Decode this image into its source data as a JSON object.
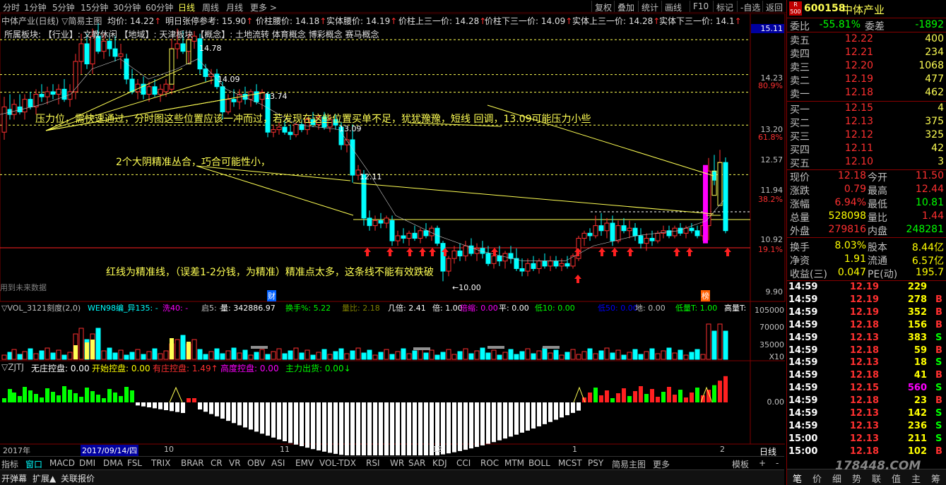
{
  "top_tabs": [
    "分时",
    "1分钟",
    "5分钟",
    "15分钟",
    "30分钟",
    "60分钟",
    "日线",
    "周线",
    "月线",
    "更多 >"
  ],
  "active_tab": "日线",
  "right_tools": [
    "复权",
    "叠加",
    "统计",
    "画线",
    "F10",
    "标记",
    "-自选",
    "返回"
  ],
  "header": {
    "title": "中体产业(日线) ▽简易主图",
    "items": [
      {
        "label": "均价: 14.22",
        "color": "#ffffff"
      },
      {
        "label": "明日张停参考: 15.90",
        "color": "#ffffff"
      },
      {
        "label": "价柱腰价: 14.18",
        "color": "#ffffff"
      },
      {
        "label": "实体腰价: 14.19",
        "color": "#ffffff"
      },
      {
        "label": "价柱上三一价: 14.28",
        "color": "#ffffff"
      },
      {
        "label": "价柱下三一价: 14.09",
        "color": "#ffffff"
      },
      {
        "label": "实体上三一价: 14.28",
        "color": "#ffffff"
      },
      {
        "label": "实体下三一价: 14.1",
        "color": "#ffffff"
      }
    ]
  },
  "info_line": "所属板块:    【行业】: 文教休闲     【地域】: 天津板块     【概念】: 土地流转 体育概念 博彩概念 赛马概念",
  "price_levels": [
    {
      "label": "14.78"
    },
    {
      "label": "14.09"
    },
    {
      "label": "13.74"
    },
    {
      "label": "13.09"
    },
    {
      "label": "12.11"
    },
    {
      "label": "←10.00"
    }
  ],
  "annotations": [
    {
      "text": "压力位，需快速通过，分时图这些位置应该一冲而过，若发现在这些位置买单不足，犹犹豫豫，短线  回调，13.09可能压力小些"
    },
    {
      "text": "2个大阴精准丛合，巧合可能性小，"
    },
    {
      "text": "红线为精准线，（误差1-2分钱，为精准）精准点太多，这条线不能有效跌破"
    },
    {
      "text": "用到未来数据"
    }
  ],
  "markers": [
    "财",
    "榜"
  ],
  "price_axis": [
    {
      "label": "15.11",
      "highlight": true
    },
    {
      "label": "14.23"
    },
    {
      "label": "80.9%",
      "pct": true
    },
    {
      "label": "13.20"
    },
    {
      "label": "61.8%",
      "pct": true
    },
    {
      "label": "12.57"
    },
    {
      "label": "11.94"
    },
    {
      "label": "38.2%",
      "pct": true
    },
    {
      "label": "10.92"
    },
    {
      "label": "19.1%",
      "pct": true
    },
    {
      "label": "9.90"
    }
  ],
  "vol_header": {
    "items": [
      {
        "label": "▽VOL_3121刻度(2,0)",
        "color": "#c0c0c0"
      },
      {
        "label": "WEN98编_异135: -",
        "color": "#00ffff"
      },
      {
        "label": "洗40: -",
        "color": "#ff00ff"
      },
      {
        "label": "启5: -",
        "color": "#c0c0c0"
      },
      {
        "label": "量: 342886.97",
        "color": "#ffffff"
      },
      {
        "label": "换手%: 5.22",
        "color": "#00ff00"
      },
      {
        "label": "量比: 2.18",
        "color": "#808000"
      },
      {
        "label": "几倍: 2.41",
        "color": "#ffffff"
      },
      {
        "label": "倍: 1.00",
        "color": "#ffffff"
      },
      {
        "label": "倍缩: 0.00",
        "color": "#ff00ff"
      },
      {
        "label": "平: 0.00",
        "color": "#ffffff"
      },
      {
        "label": "低10: 0.00",
        "color": "#00ff00"
      },
      {
        "label": "低50: 0.00",
        "color": "#0000ff"
      },
      {
        "label": "地: 0.00",
        "color": "#c0c0c0"
      },
      {
        "label": "低量T: 1.00",
        "color": "#00ff00"
      },
      {
        "label": "高量T:",
        "color": "#ffffff"
      }
    ],
    "axis": [
      "105000",
      "70000",
      "35000",
      "X10"
    ]
  },
  "zj_header": {
    "items": [
      {
        "label": "▽ZJTJ",
        "color": "#c0c0c0"
      },
      {
        "label": "无庄控盘: 0.00",
        "color": "#ffffff"
      },
      {
        "label": "开始控盘: 0.00",
        "color": "#ffff00"
      },
      {
        "label": "有庄控盘: 1.49↑",
        "color": "#ff3030"
      },
      {
        "label": "高度控盘: 0.00",
        "color": "#ff00ff"
      },
      {
        "label": "主力出货: 0.00↓",
        "color": "#00ff00"
      }
    ],
    "axis": [
      "0.00"
    ]
  },
  "date_axis": [
    {
      "label": "2017年"
    },
    {
      "label": "2017/09/14/四",
      "highlight": true
    },
    {
      "label": "10"
    },
    {
      "label": "11"
    },
    {
      "label": "12"
    },
    {
      "label": "1"
    },
    {
      "label": "2"
    }
  ],
  "date_axis_right": "日线",
  "bottom_tabs": [
    "指标",
    "窗口",
    "MACD",
    "DMI",
    "DMA",
    "FSL",
    "TRIX",
    "BRAR",
    "CR",
    "VR",
    "OBV",
    "ASI",
    "EMV",
    "VOL-TDX",
    "RSI",
    "WR",
    "SAR",
    "KDJ",
    "CCI",
    "ROC",
    "MTM",
    "BOLL",
    "MCST",
    "PSY",
    "简易主图",
    "更多"
  ],
  "bottom_right": [
    "模板",
    "+",
    "-"
  ],
  "statusbar": [
    "开弹幕",
    "扩展▲",
    "关联报价"
  ],
  "quote": {
    "code": "600158",
    "name": "中体产业",
    "badge_top": "R",
    "badge_bottom": "500",
    "weibi_label": "委比",
    "weibi_value": "-55.81%",
    "weicha_label": "委差",
    "weicha_value": "-1892",
    "sells": [
      {
        "label": "卖五",
        "price": "12.22",
        "vol": "400"
      },
      {
        "label": "卖四",
        "price": "12.21",
        "vol": "234"
      },
      {
        "label": "卖三",
        "price": "12.20",
        "vol": "1068"
      },
      {
        "label": "卖二",
        "price": "12.19",
        "vol": "477"
      },
      {
        "label": "卖一",
        "price": "12.18",
        "vol": "462"
      }
    ],
    "buys": [
      {
        "label": "买一",
        "price": "12.15",
        "vol": "4"
      },
      {
        "label": "买二",
        "price": "12.13",
        "vol": "375"
      },
      {
        "label": "买三",
        "price": "12.12",
        "vol": "325"
      },
      {
        "label": "买四",
        "price": "12.11",
        "vol": "42"
      },
      {
        "label": "买五",
        "price": "12.10",
        "vol": "3"
      }
    ],
    "stats": [
      {
        "l1": "现价",
        "v1": "12.18",
        "c1": "#ff3030",
        "l2": "今开",
        "v2": "11.50",
        "c2": "#ff3030"
      },
      {
        "l1": "涨跌",
        "v1": "0.79",
        "c1": "#ff3030",
        "l2": "最高",
        "v2": "12.44",
        "c2": "#ff3030"
      },
      {
        "l1": "涨幅",
        "v1": "6.94%",
        "c1": "#ff3030",
        "l2": "最低",
        "v2": "10.81",
        "c2": "#00ff00"
      },
      {
        "l1": "总量",
        "v1": "528098",
        "c1": "#ffff00",
        "l2": "量比",
        "v2": "1.44",
        "c2": "#ff3030"
      },
      {
        "l1": "外盘",
        "v1": "279816",
        "c1": "#ff3030",
        "l2": "内盘",
        "v2": "248281",
        "c2": "#00ff00"
      },
      {
        "l1": "换手",
        "v1": "8.03%",
        "c1": "#ffff00",
        "l2": "股本",
        "v2": "8.44亿",
        "c2": "#ffff00"
      },
      {
        "l1": "净资",
        "v1": "1.91",
        "c1": "#ffff00",
        "l2": "流通",
        "v2": "6.57亿",
        "c2": "#ffff00"
      },
      {
        "l1": "收益(三)",
        "v1": "0.047",
        "c1": "#ffff00",
        "l2": "PE(动)",
        "v2": "195.7",
        "c2": "#ffff00"
      }
    ],
    "ticks": [
      {
        "time": "14:59",
        "price": "12.19",
        "vol": "229",
        "bs": "",
        "pc": "#ff3030",
        "vc": "#ffff00"
      },
      {
        "time": "14:59",
        "price": "12.19",
        "vol": "278",
        "bs": "B",
        "pc": "#ff3030",
        "vc": "#ffff00"
      },
      {
        "time": "14:59",
        "price": "12.19",
        "vol": "352",
        "bs": "B",
        "pc": "#ff3030",
        "vc": "#ffff00"
      },
      {
        "time": "14:59",
        "price": "12.18",
        "vol": "156",
        "bs": "B",
        "pc": "#ff3030",
        "vc": "#ffff00"
      },
      {
        "time": "14:59",
        "price": "12.13",
        "vol": "383",
        "bs": "S",
        "pc": "#ff3030",
        "vc": "#ffff00"
      },
      {
        "time": "14:59",
        "price": "12.18",
        "vol": "59",
        "bs": "B",
        "pc": "#ff3030",
        "vc": "#ffff00"
      },
      {
        "time": "14:59",
        "price": "12.13",
        "vol": "18",
        "bs": "S",
        "pc": "#ff3030",
        "vc": "#ffff00"
      },
      {
        "time": "14:59",
        "price": "12.18",
        "vol": "41",
        "bs": "B",
        "pc": "#ff3030",
        "vc": "#ffff00"
      },
      {
        "time": "14:59",
        "price": "12.15",
        "vol": "560",
        "bs": "S",
        "pc": "#ff3030",
        "vc": "#ff00ff"
      },
      {
        "time": "14:59",
        "price": "12.18",
        "vol": "23",
        "bs": "B",
        "pc": "#ff3030",
        "vc": "#ffff00"
      },
      {
        "time": "14:59",
        "price": "12.13",
        "vol": "142",
        "bs": "S",
        "pc": "#ff3030",
        "vc": "#ffff00"
      },
      {
        "time": "14:59",
        "price": "12.13",
        "vol": "236",
        "bs": "S",
        "pc": "#ff3030",
        "vc": "#ffff00"
      },
      {
        "time": "15:00",
        "price": "12.13",
        "vol": "211",
        "bs": "S",
        "pc": "#ff3030",
        "vc": "#ffff00"
      },
      {
        "time": "15:00",
        "price": "12.18",
        "vol": "102",
        "bs": "B",
        "pc": "#ff3030",
        "vc": "#ffff00"
      }
    ],
    "bottom_tabs": [
      "笔",
      "价",
      "细",
      "势",
      "联",
      "值",
      "主",
      "筹"
    ],
    "watermark": "178448.COM"
  },
  "colors": {
    "up": "#ff3030",
    "down": "#00ffff",
    "ma": "#ffff00",
    "bg": "#000000",
    "grid": "#800000"
  }
}
